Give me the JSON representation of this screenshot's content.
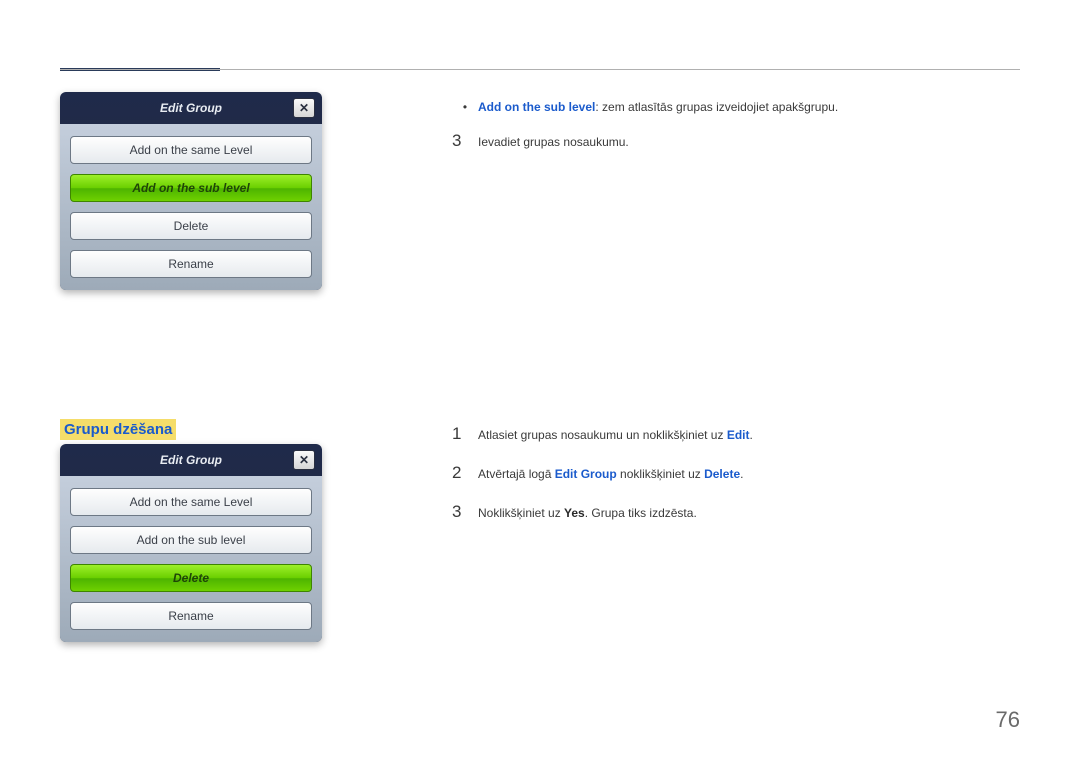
{
  "page_number": "76",
  "dialog1": {
    "title": "Edit Group",
    "close": "✕",
    "options": {
      "same": "Add on the same Level",
      "sub": "Add on the sub level",
      "delete": "Delete",
      "rename": "Rename"
    }
  },
  "dialog2": {
    "title": "Edit Group",
    "close": "✕",
    "options": {
      "same": "Add on the same Level",
      "sub": "Add on the sub level",
      "delete": "Delete",
      "rename": "Rename"
    }
  },
  "section_title": "Grupu dzēšana",
  "top_bullet": {
    "label": "Add on the sub level",
    "rest": ": zem atlasītās grupas izveidojiet apakšgrupu."
  },
  "top_step3": {
    "num": "3",
    "text": "Ievadiet grupas nosaukumu."
  },
  "steps": {
    "s1": {
      "num": "1",
      "pre": "Atlasiet grupas nosaukumu un noklikšķiniet uz ",
      "bold": "Edit",
      "post": "."
    },
    "s2": {
      "num": "2",
      "pre": "Atvērtajā logā ",
      "bold1": "Edit Group",
      "mid": " noklikšķiniet uz ",
      "bold2": "Delete",
      "post": "."
    },
    "s3": {
      "num": "3",
      "pre": "Noklikšķiniet uz ",
      "bold": "Yes",
      "post": ". Grupa tiks izdzēsta."
    }
  }
}
